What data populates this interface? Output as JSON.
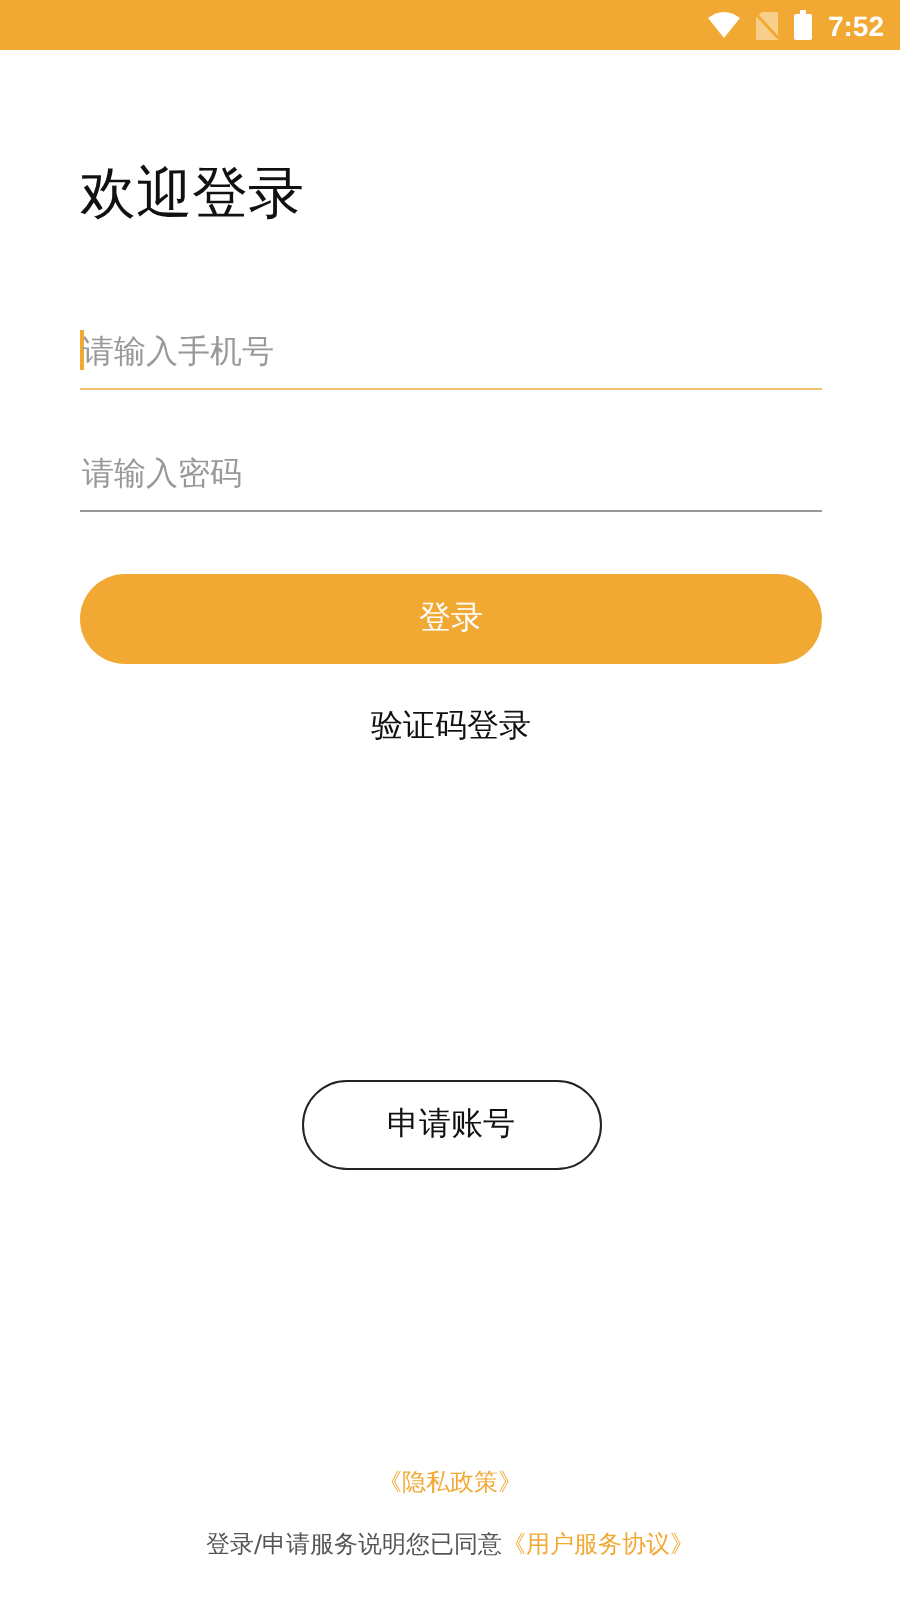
{
  "status_bar": {
    "time": "7:52"
  },
  "title": "欢迎登录",
  "fields": [
    {
      "placeholder": "请输入手机号",
      "focused": true
    },
    {
      "placeholder": "请输入密码",
      "focused": false
    }
  ],
  "login_button": "登录",
  "code_login_link": "验证码登录",
  "apply_button": "申请账号",
  "footer": {
    "privacy_link": "《隐私政策》",
    "agreement_text": "登录/申请服务说明您已同意",
    "agreement_link": "《用户服务协议》"
  }
}
